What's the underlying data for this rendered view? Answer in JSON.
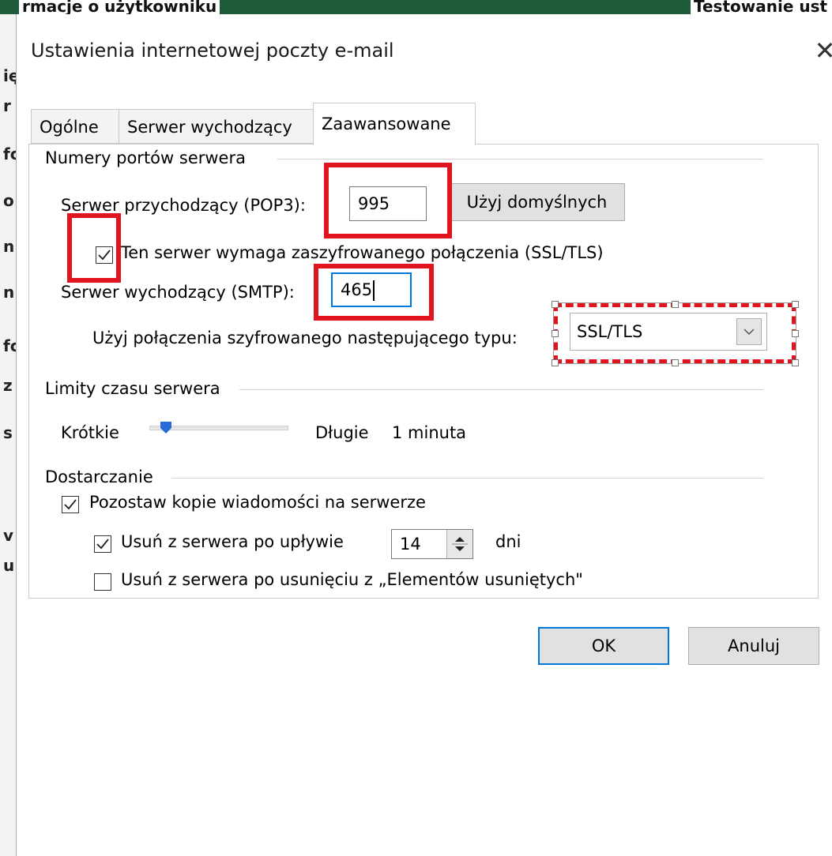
{
  "background": {
    "title_left": "rmacje o użytkowniku",
    "title_right": "Testowanie ust",
    "side_letters": [
      "ię",
      "r",
      "fc",
      "o",
      "n",
      "n",
      "fc",
      "z",
      "s",
      "v",
      "u"
    ]
  },
  "dialog": {
    "title": "Ustawienia internetowej poczty e-mail",
    "close_glyph": "✕"
  },
  "tabs": [
    {
      "label": "Ogólne",
      "active": false
    },
    {
      "label": "Serwer wychodzący",
      "active": false
    },
    {
      "label": "Zaawansowane",
      "active": true
    }
  ],
  "ports": {
    "group_label": "Numery portów serwera",
    "incoming_label": "Serwer przychodzący (POP3):",
    "incoming_value": "995",
    "default_button": "Użyj domyślnych",
    "ssl_checkbox_label": "Ten serwer wymaga zaszyfrowanego połączenia (SSL/TLS)",
    "ssl_checked": true,
    "outgoing_label": "Serwer wychodzący (SMTP):",
    "outgoing_value": "465",
    "encryption_label": "Użyj połączenia szyfrowanego następującego typu:",
    "encryption_value": "SSL/TLS"
  },
  "timeouts": {
    "group_label": "Limity czasu serwera",
    "short_label": "Krótkie",
    "long_label": "Długie",
    "value_label": "1 minuta",
    "slider_level": 0.12
  },
  "delivery": {
    "group_label": "Dostarczanie",
    "leave_copy_label": "Pozostaw kopie wiadomości na serwerze",
    "leave_copy_checked": true,
    "remove_after_label": "Usuń z serwera po upływie",
    "remove_after_checked": true,
    "remove_after_days": "14",
    "days_unit": "dni",
    "remove_deleted_label": "Usuń z serwera po usunięciu z „Elementów usuniętych\"",
    "remove_deleted_checked": false
  },
  "buttons": {
    "ok": "OK",
    "cancel": "Anuluj"
  },
  "colors": {
    "highlight_red": "#e0151f",
    "focus_blue": "#0078d7",
    "slider_thumb": "#2a6ad8",
    "bg_topbar": "#1e5b3a"
  }
}
